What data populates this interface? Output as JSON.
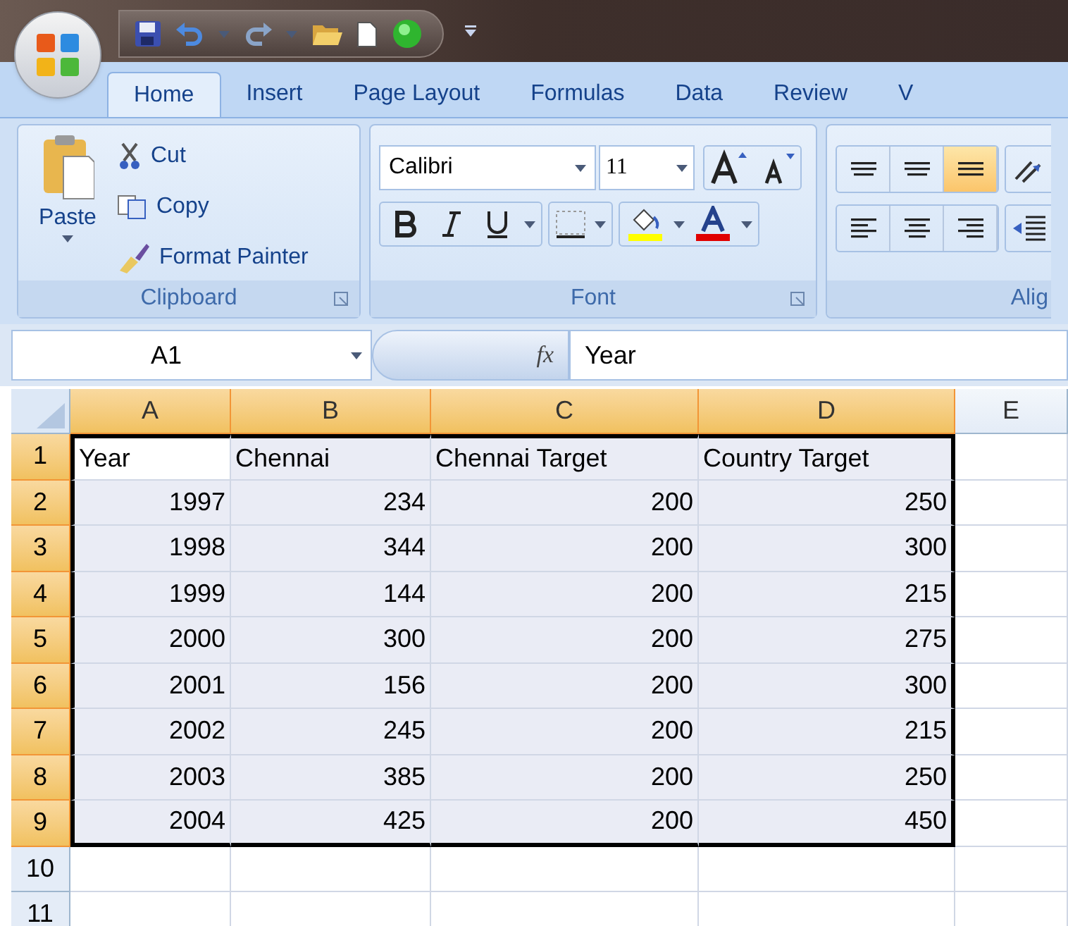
{
  "tabs": [
    {
      "label": "Home",
      "selected": true
    },
    {
      "label": "Insert",
      "selected": false
    },
    {
      "label": "Page Layout",
      "selected": false
    },
    {
      "label": "Formulas",
      "selected": false
    },
    {
      "label": "Data",
      "selected": false
    },
    {
      "label": "Review",
      "selected": false
    },
    {
      "label": "V",
      "selected": false
    }
  ],
  "clipboard": {
    "paste": "Paste",
    "actions": [
      "Cut",
      "Copy",
      "Format Painter"
    ],
    "label": "Clipboard"
  },
  "font": {
    "name": "Calibri",
    "size": "11",
    "label": "Font"
  },
  "alignment": {
    "label": "Alig",
    "vertical": [
      {
        "selected": false
      },
      {
        "selected": false
      },
      {
        "selected": true
      }
    ]
  },
  "formula_bar": {
    "name_box": "A1",
    "function_symbol": "fx",
    "value": "Year"
  },
  "columns": [
    {
      "label": "A",
      "selected": true
    },
    {
      "label": "B",
      "selected": true
    },
    {
      "label": "C",
      "selected": true
    },
    {
      "label": "D",
      "selected": true
    },
    {
      "label": "E",
      "selected": false
    }
  ],
  "rows": [
    {
      "number": "1",
      "selected": true,
      "kind": "header",
      "cells": [
        "Year",
        "Chennai",
        "Chennai Target",
        "Country Target"
      ]
    },
    {
      "number": "2",
      "selected": true,
      "kind": "data",
      "cells": [
        "1997",
        "234",
        "200",
        "250"
      ]
    },
    {
      "number": "3",
      "selected": true,
      "kind": "data",
      "cells": [
        "1998",
        "344",
        "200",
        "300"
      ]
    },
    {
      "number": "4",
      "selected": true,
      "kind": "data",
      "cells": [
        "1999",
        "144",
        "200",
        "215"
      ]
    },
    {
      "number": "5",
      "selected": true,
      "kind": "data",
      "cells": [
        "2000",
        "300",
        "200",
        "275"
      ]
    },
    {
      "number": "6",
      "selected": true,
      "kind": "data",
      "cells": [
        "2001",
        "156",
        "200",
        "300"
      ]
    },
    {
      "number": "7",
      "selected": true,
      "kind": "data",
      "cells": [
        "2002",
        "245",
        "200",
        "215"
      ]
    },
    {
      "number": "8",
      "selected": true,
      "kind": "data",
      "cells": [
        "2003",
        "385",
        "200",
        "250"
      ]
    },
    {
      "number": "9",
      "selected": true,
      "kind": "data",
      "cells": [
        "2004",
        "425",
        "200",
        "450"
      ]
    },
    {
      "number": "10",
      "selected": false,
      "kind": "data",
      "cells": []
    },
    {
      "number": "11",
      "selected": false,
      "kind": "data",
      "cells": []
    }
  ]
}
